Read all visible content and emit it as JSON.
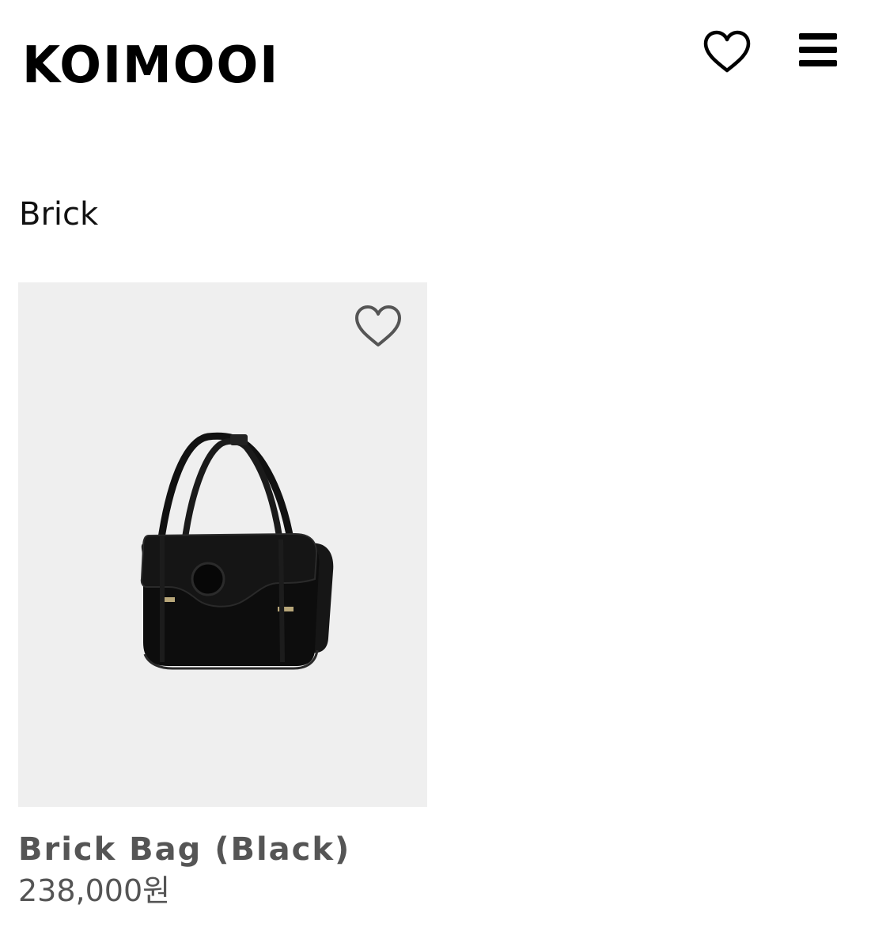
{
  "header": {
    "logo": "KOIMOOI",
    "wishlist_icon": "heart-outline-icon",
    "menu_icon": "hamburger-menu-icon"
  },
  "category": {
    "title": "Brick"
  },
  "products": [
    {
      "name": "Brick Bag (Black)",
      "price": "238,000원",
      "wishlist_icon": "heart-outline-icon",
      "image_background": "#efefef"
    }
  ],
  "colors": {
    "text_primary": "#000000",
    "text_secondary": "#555555",
    "image_bg": "#efefef"
  }
}
